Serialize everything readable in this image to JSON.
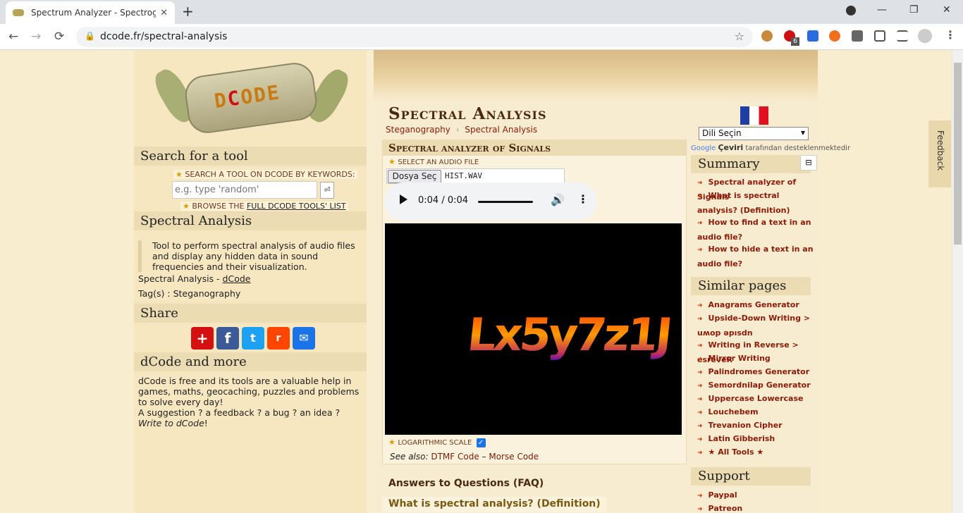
{
  "browser": {
    "tab_title": "Spectrum Analyzer - Spectrogram",
    "tab_close": "✕",
    "new_tab": "+",
    "url": "dcode.fr/spectral-analysis",
    "lock_icon": "🔒",
    "back": "←",
    "forward": "→",
    "reload": "⟳",
    "minimize": "—",
    "maximize": "❐",
    "close": "✕",
    "bookmark": "☆",
    "badge_count": "6"
  },
  "left": {
    "logo_text": "DCODE",
    "search_title": "Search for a tool",
    "search_label": "SEARCH A TOOL ON DCODE BY KEYWORDS:",
    "search_placeholder": "e.g. type 'random'",
    "search_go": "⏎",
    "browse_prefix": "BROWSE THE ",
    "browse_link": "FULL DCODE TOOLS' LIST",
    "tool_title": "Spectral Analysis",
    "tool_desc": "Tool to perform spectral analysis of audio files and display any hidden data in sound frequencies and their visualization.",
    "tool_name": "Spectral Analysis - ",
    "tool_author": "dCode",
    "tags": "Tag(s) : Steganography",
    "share_title": "Share",
    "more_title": "dCode and more",
    "more_text": "dCode is free and its tools are a valuable help in games, maths, geocaching, puzzles and problems to solve every day!",
    "suggest_text": "A suggestion ? a feedback ? a bug ? an idea ? ",
    "suggest_link": "Write to dCode",
    "suggest_end": "!"
  },
  "main": {
    "title": "Spectral Analysis",
    "breadcrumb_1": "Steganography",
    "breadcrumb_sep": "›",
    "breadcrumb_2": "Spectral Analysis",
    "panel_title": "Spectral analyzer of Signals",
    "select_label": "SELECT AN AUDIO FILE",
    "file_button": "Dosya Seç",
    "file_name": "HIST.WAV",
    "audio_time": "0:04 / 0:04",
    "spectro_text": "Lx5y7z1J",
    "log_label": "LOGARITHMIC SCALE",
    "see_also": "See also: ",
    "see_also_1": "DTMF Code",
    "see_also_sep": " – ",
    "see_also_2": "Morse Code",
    "faq_title": "Answers to Questions (FAQ)",
    "faq_1": "What is spectral analysis? (Definition)"
  },
  "right": {
    "lang_select": "Dili Seçin",
    "translate_brand": "Google",
    "translate_word": "Çeviri",
    "translate_rest": "tarafından desteklenmektedir",
    "summary_title": "Summary",
    "summary_toggle": "⊟",
    "summary": [
      "Spectral analyzer of Signals",
      "What is spectral analysis? (Definition)",
      "How to find a text in an audio file?",
      "How to hide a text in an audio file?"
    ],
    "similar_title": "Similar pages",
    "similar": [
      "Anagrams Generator",
      "Upside-Down Writing > uʍop əpısdn",
      "Writing in Reverse > esreveR",
      "Mirror Writing",
      "Palindromes Generator",
      "Semordnilap Generator",
      "Uppercase Lowercase",
      "Louchebem",
      "Trevanion Cipher",
      "Latin Gibberish",
      "★ All Tools ★"
    ],
    "support_title": "Support",
    "support": [
      "Paypal",
      "Patreon"
    ],
    "feedback": "Feedback"
  },
  "colors": {
    "page_bg": "#f8edce",
    "link": "#8b1a08",
    "heading": "#4a2a10"
  }
}
